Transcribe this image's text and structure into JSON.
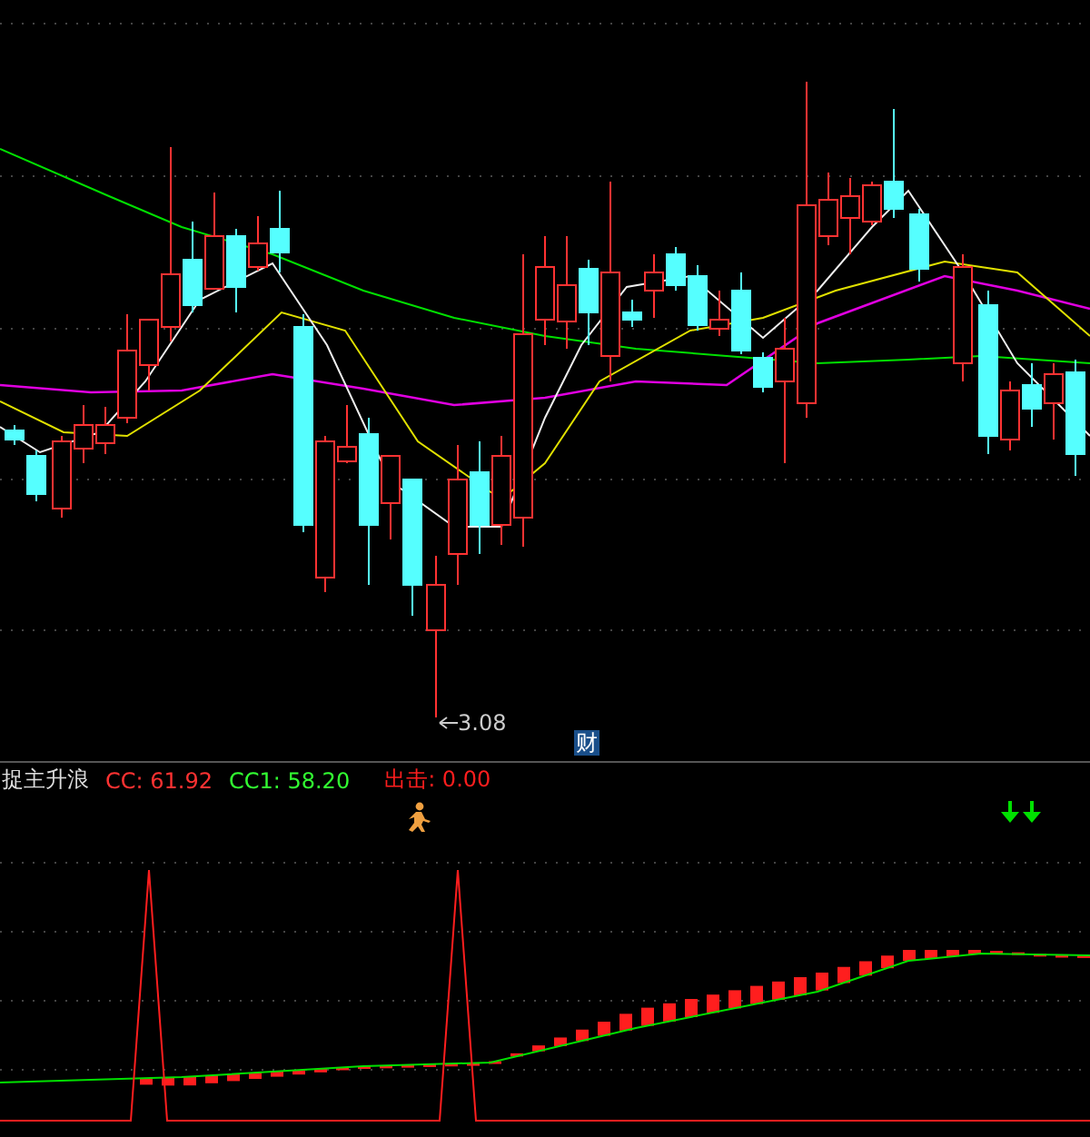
{
  "main_chart": {
    "low_label": "3.08",
    "badge": "财"
  },
  "indicator": {
    "name": "捉主升浪",
    "values": [
      {
        "text": "CC: 61.92",
        "color": "#ff3232"
      },
      {
        "text": "CC1: 58.20",
        "color": "#32ff32"
      },
      {
        "text": "出击: 0.00",
        "color": "#ff1e1e"
      }
    ]
  }
}
